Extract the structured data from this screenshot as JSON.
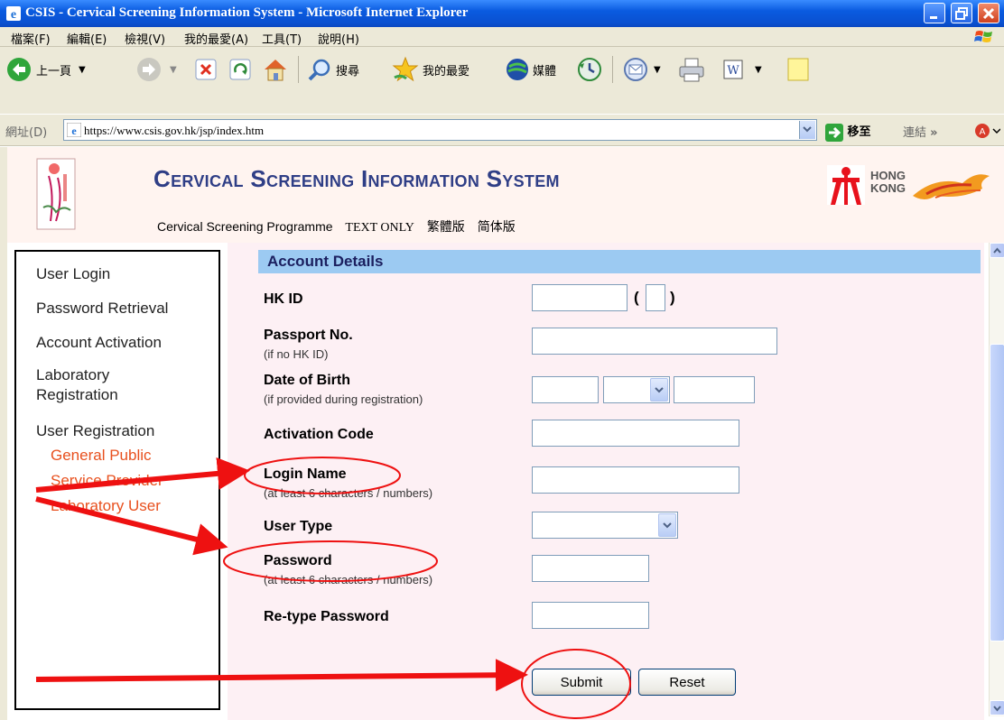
{
  "window": {
    "title": "CSIS - Cervical Screening Information System - Microsoft Internet Explorer"
  },
  "menu": [
    "檔案(F)",
    "編輯(E)",
    "檢視(V)",
    "我的最愛(A)",
    "工具(T)",
    "說明(H)"
  ],
  "toolbar": {
    "back": "上一頁",
    "search": "搜尋",
    "favorites": "我的最愛",
    "media": "媒體"
  },
  "address": {
    "label": "網址(D)",
    "url": "https://www.csis.gov.hk/jsp/index.htm",
    "go": "移至",
    "links": "連結"
  },
  "header": {
    "title": "Cervical Screening Information System",
    "hk_logo_text": [
      "HONG",
      "KONG"
    ],
    "links": [
      "Cervical Screening Programme",
      "TEXT ONLY",
      "繁體版",
      "简体版"
    ]
  },
  "nav": {
    "items": [
      "User Login",
      "Password Retrieval",
      "Account Activation",
      "Laboratory Registration",
      "User Registration"
    ],
    "subitems": [
      "General Public",
      "Service Provider",
      "Laboratory User"
    ]
  },
  "form": {
    "section_title": "Account Details",
    "hkid": {
      "label": "HK ID",
      "value": "",
      "check_digit": ""
    },
    "passport": {
      "label": "Passport No.",
      "note": "(if no HK ID)",
      "value": ""
    },
    "dob": {
      "label": "Date of Birth",
      "note": "(if provided during registration)",
      "day": "",
      "month": "",
      "year": ""
    },
    "activation_code": {
      "label": "Activation Code",
      "value": ""
    },
    "login_name": {
      "label": "Login Name",
      "note": "(at least 6 characters / numbers)",
      "value": ""
    },
    "user_type": {
      "label": "User Type",
      "value": ""
    },
    "password": {
      "label": "Password",
      "note": "(at least 6 characters / numbers)",
      "value": ""
    },
    "retype_password": {
      "label": "Re-type Password",
      "value": ""
    },
    "submit_label": "Submit",
    "reset_label": "Reset"
  },
  "colors": {
    "annotation": "#ee1111",
    "nav_sub": "#e8501e",
    "title": "#2f3e86",
    "section_bar": "#9ccaf2"
  }
}
